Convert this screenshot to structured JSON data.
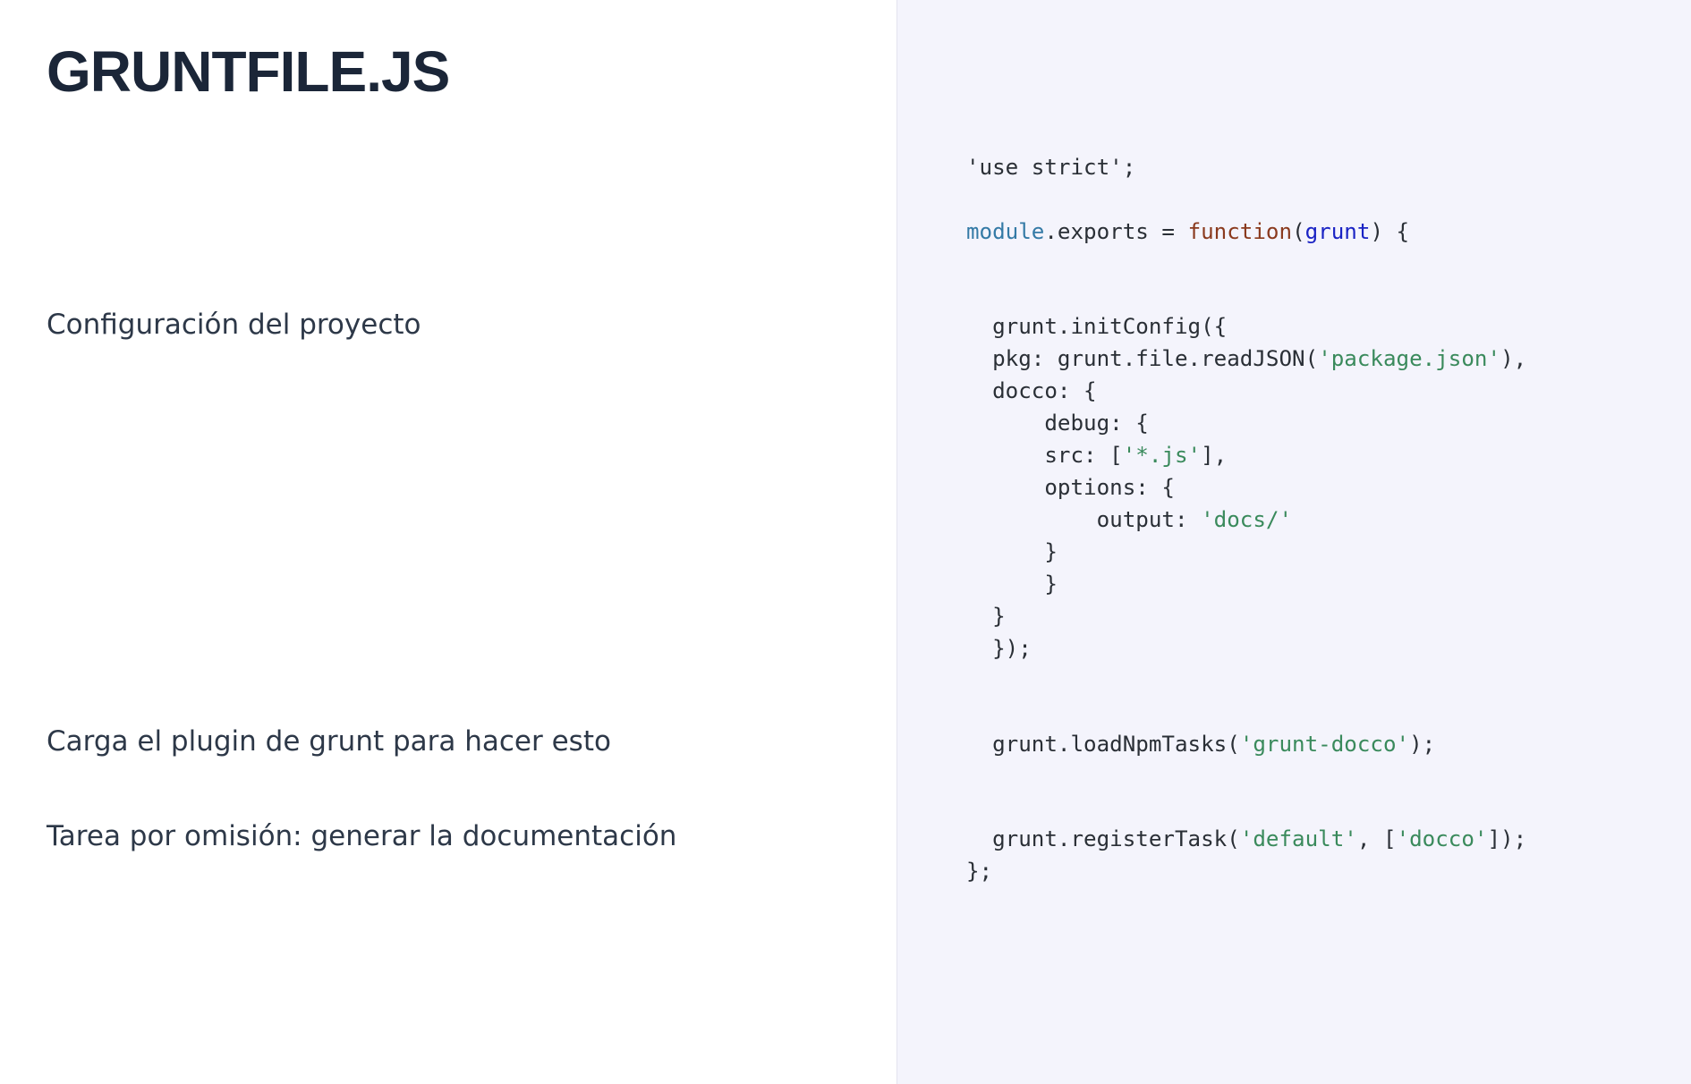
{
  "title": "GRUNTFILE.JS",
  "sections": [
    {
      "comment": "",
      "code": [
        [
          {
            "t": "'use strict';",
            "k": "plain"
          }
        ],
        [],
        [
          {
            "t": "module",
            "k": "builtin"
          },
          {
            "t": ".exports = ",
            "k": "plain"
          },
          {
            "t": "function",
            "k": "keyword"
          },
          {
            "t": "(",
            "k": "plain"
          },
          {
            "t": "grunt",
            "k": "param"
          },
          {
            "t": ") {",
            "k": "plain"
          }
        ]
      ]
    },
    {
      "comment": "Configuración del proyecto",
      "code": [
        [
          {
            "t": "  grunt.initConfig({",
            "k": "plain"
          }
        ],
        [
          {
            "t": "  pkg: grunt.file.readJSON(",
            "k": "plain"
          },
          {
            "t": "'package.json'",
            "k": "str"
          },
          {
            "t": "),",
            "k": "plain"
          }
        ],
        [
          {
            "t": "  docco: {",
            "k": "plain"
          }
        ],
        [
          {
            "t": "      debug: {",
            "k": "plain"
          }
        ],
        [
          {
            "t": "      src: [",
            "k": "plain"
          },
          {
            "t": "'*.js'",
            "k": "str"
          },
          {
            "t": "],",
            "k": "plain"
          }
        ],
        [
          {
            "t": "      options: {",
            "k": "plain"
          }
        ],
        [
          {
            "t": "          output: ",
            "k": "plain"
          },
          {
            "t": "'docs/'",
            "k": "str"
          }
        ],
        [
          {
            "t": "      }",
            "k": "plain"
          }
        ],
        [
          {
            "t": "      }",
            "k": "plain"
          }
        ],
        [
          {
            "t": "  }",
            "k": "plain"
          }
        ],
        [
          {
            "t": "  });",
            "k": "plain"
          }
        ]
      ]
    },
    {
      "comment": "Carga el plugin de grunt para hacer esto",
      "code": [
        [
          {
            "t": "  grunt.loadNpmTasks(",
            "k": "plain"
          },
          {
            "t": "'grunt-docco'",
            "k": "str"
          },
          {
            "t": ");",
            "k": "plain"
          }
        ]
      ]
    },
    {
      "comment": "Tarea por omisión: generar la documentación",
      "code": [
        [
          {
            "t": "  grunt.registerTask(",
            "k": "plain"
          },
          {
            "t": "'default'",
            "k": "str"
          },
          {
            "t": ", [",
            "k": "plain"
          },
          {
            "t": "'docco'",
            "k": "str"
          },
          {
            "t": "]);",
            "k": "plain"
          }
        ],
        [
          {
            "t": "};",
            "k": "plain"
          }
        ]
      ]
    }
  ]
}
